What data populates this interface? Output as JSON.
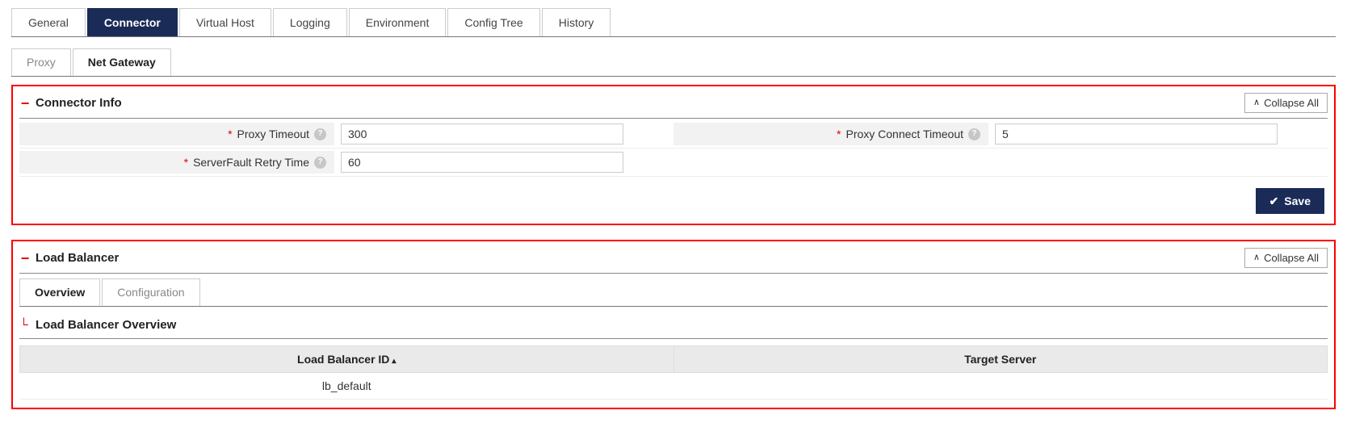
{
  "top_tabs": {
    "general": "General",
    "connector": "Connector",
    "virtual_host": "Virtual Host",
    "logging": "Logging",
    "environment": "Environment",
    "config_tree": "Config Tree",
    "history": "History"
  },
  "sub_tabs": {
    "proxy": "Proxy",
    "net_gateway": "Net Gateway"
  },
  "connector_info": {
    "title": "Connector Info",
    "collapse_all": "Collapse All",
    "fields": {
      "proxy_timeout_label": "Proxy Timeout",
      "proxy_timeout_value": "300",
      "proxy_connect_timeout_label": "Proxy Connect Timeout",
      "proxy_connect_timeout_value": "5",
      "serverfault_retry_label": "ServerFault Retry Time",
      "serverfault_retry_value": "60"
    },
    "save_label": "Save"
  },
  "load_balancer": {
    "title": "Load Balancer",
    "collapse_all": "Collapse All",
    "tabs": {
      "overview": "Overview",
      "configuration": "Configuration"
    },
    "overview_title": "Load Balancer Overview",
    "table": {
      "col_id": "Load Balancer ID",
      "col_target": "Target Server",
      "rows": [
        {
          "id": "lb_default",
          "target": ""
        }
      ]
    }
  }
}
